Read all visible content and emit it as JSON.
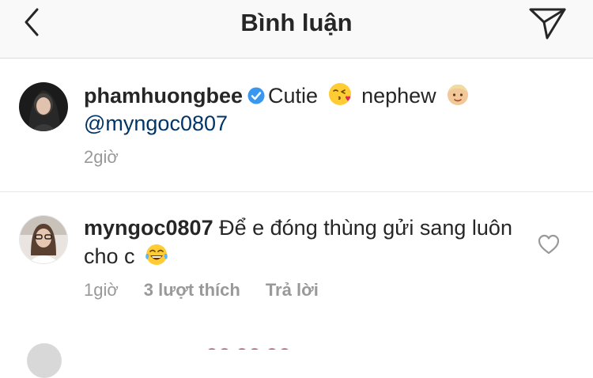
{
  "header": {
    "title": "Bình luận",
    "back_icon": "chevron-left-icon",
    "send_icon": "paper-plane-icon"
  },
  "comments": [
    {
      "username": "phamhuongbee",
      "verified": true,
      "text": "Cutie",
      "emoji_1": "kissing-heart-emoji",
      "text_2": "nephew",
      "emoji_2": "baby-emoji",
      "mention": "@myngoc0807",
      "time": "2giờ"
    },
    {
      "username": "myngoc0807",
      "text": "Để e đóng thùng gửi sang luôn cho c",
      "emoji": "tears-of-joy-emoji",
      "time": "1giờ",
      "likes": "3 lượt thích",
      "reply": "Trả lời",
      "like_icon": "heart-outline-icon"
    }
  ],
  "colors": {
    "header_bg": "#f9f9f9",
    "text": "#262626",
    "meta": "#999999",
    "mention": "#003569",
    "verified": "#3897f0",
    "divider": "#e6e6e6"
  }
}
